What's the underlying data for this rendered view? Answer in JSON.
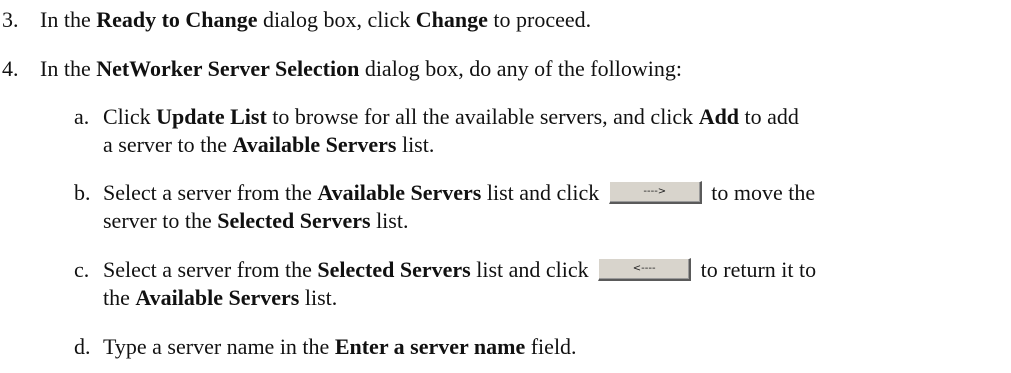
{
  "steps": [
    {
      "number": "3.",
      "parts": [
        "In the ",
        "Ready to Change",
        " dialog box, click ",
        "Change",
        " to proceed."
      ]
    },
    {
      "number": "4.",
      "parts": [
        "In the ",
        "NetWorker Server Selection",
        " dialog box, do any of the following:"
      ]
    }
  ],
  "substeps": {
    "a": {
      "letter": "a.",
      "line1": [
        "Click ",
        "Update List",
        " to browse for all the available servers, and click ",
        "Add",
        " to add"
      ],
      "line2": [
        "a server to the ",
        "Available Servers",
        " list."
      ]
    },
    "b": {
      "letter": "b.",
      "line1": [
        "Select a server from the ",
        "Available Servers",
        " list and click ",
        " to move the"
      ],
      "button_label": "---->",
      "line2": [
        "server to the ",
        "Selected Servers",
        " list."
      ]
    },
    "c": {
      "letter": "c.",
      "line1": [
        "Select a server from the ",
        "Selected Servers",
        " list and click ",
        " to return it to"
      ],
      "button_label": "<----",
      "line2": [
        "the ",
        "Available Servers",
        " list."
      ]
    },
    "d": {
      "letter": "d.",
      "line1": [
        "Type a server name in the ",
        "Enter a server name",
        " field."
      ]
    }
  }
}
